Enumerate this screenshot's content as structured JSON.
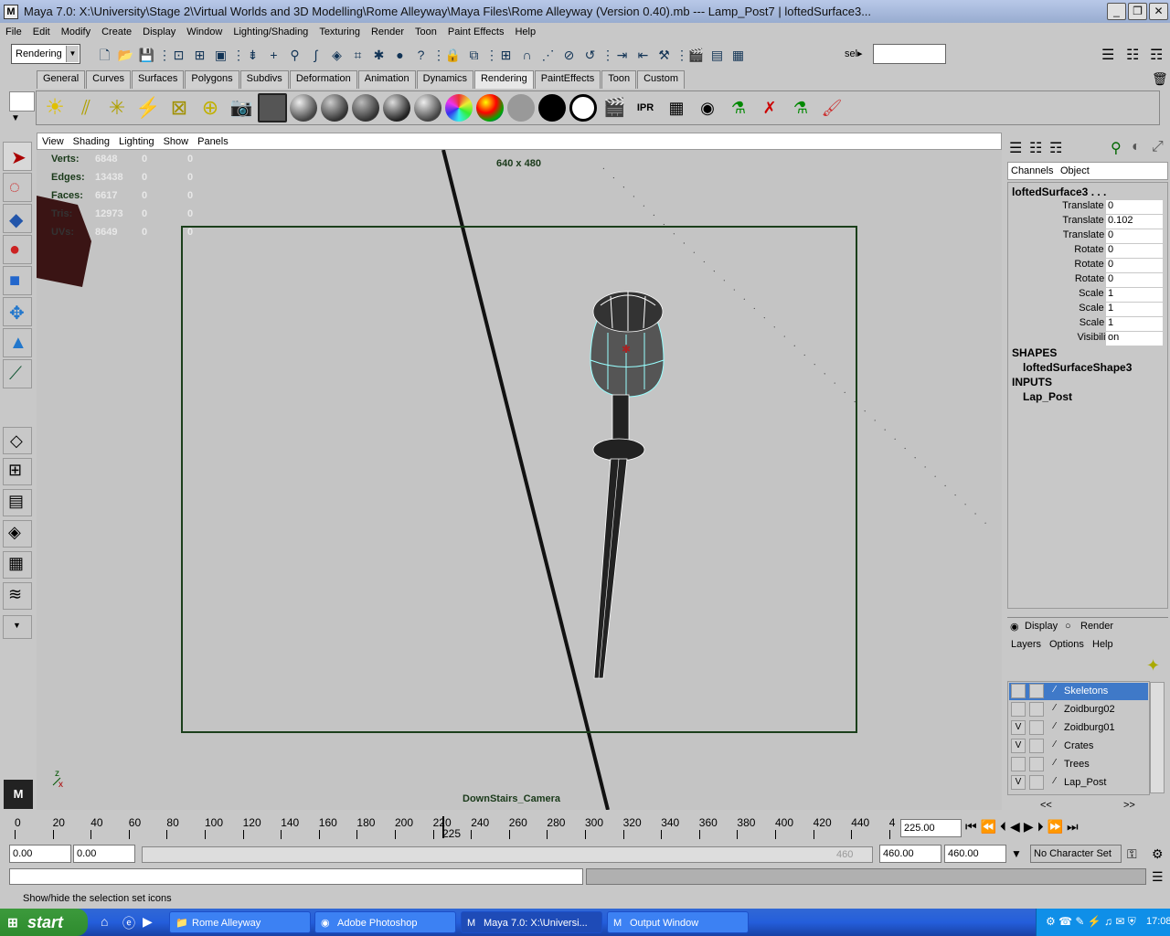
{
  "window": {
    "title": "Maya 7.0: X:\\University\\Stage 2\\Virtual Worlds and 3D Modelling\\Rome Alleyway\\Maya Files\\Rome Alleyway (Version 0.40).mb   ---   Lamp_Post7 | loftedSurface3...",
    "minimize": "_",
    "restore": "❐",
    "close": "✕"
  },
  "menubar": [
    "File",
    "Edit",
    "Modify",
    "Create",
    "Display",
    "Window",
    "Lighting/Shading",
    "Texturing",
    "Render",
    "Toon",
    "Paint Effects",
    "Help"
  ],
  "toolbar": {
    "mode": "Rendering",
    "sel_label": "sel▸"
  },
  "shelf_tabs": [
    "General",
    "Curves",
    "Surfaces",
    "Polygons",
    "Subdivs",
    "Deformation",
    "Animation",
    "Dynamics",
    "Rendering",
    "PaintEffects",
    "Toon",
    "Custom"
  ],
  "shelf_active": "Rendering",
  "viewport": {
    "menu": [
      "View",
      "Shading",
      "Lighting",
      "Show",
      "Panels"
    ],
    "resolution": "640 x 480",
    "camera": "DownStairs_Camera",
    "hud": [
      {
        "label": "Verts:",
        "v1": "6848",
        "v2": "0",
        "v3": "0"
      },
      {
        "label": "Edges:",
        "v1": "13438",
        "v2": "0",
        "v3": "0"
      },
      {
        "label": "Faces:",
        "v1": "6617",
        "v2": "0",
        "v3": "0"
      },
      {
        "label": "Tris:",
        "v1": "12973",
        "v2": "0",
        "v3": "0"
      },
      {
        "label": "UVs:",
        "v1": "8649",
        "v2": "0",
        "v3": "0"
      }
    ]
  },
  "channelbox": {
    "tabs": [
      "Channels",
      "Object"
    ],
    "object": "loftedSurface3 . . .",
    "attrs": [
      {
        "n": "Translate X",
        "v": "0"
      },
      {
        "n": "Translate Y",
        "v": "0.102"
      },
      {
        "n": "Translate Z",
        "v": "0"
      },
      {
        "n": "Rotate X",
        "v": "0"
      },
      {
        "n": "Rotate Y",
        "v": "0"
      },
      {
        "n": "Rotate Z",
        "v": "0"
      },
      {
        "n": "Scale X",
        "v": "1"
      },
      {
        "n": "Scale Y",
        "v": "1"
      },
      {
        "n": "Scale Z",
        "v": "1"
      },
      {
        "n": "Visibility",
        "v": "on"
      }
    ],
    "shapes_header": "SHAPES",
    "shape": "loftedSurfaceShape3",
    "inputs_header": "INPUTS",
    "input": "Lap_Post"
  },
  "layers": {
    "display": "Display",
    "render": "Render",
    "menu": [
      "Layers",
      "Options",
      "Help"
    ],
    "items": [
      {
        "v": "",
        "name": "Skeletons"
      },
      {
        "v": "",
        "name": "Zoidburg02"
      },
      {
        "v": "V",
        "name": "Zoidburg01"
      },
      {
        "v": "V",
        "name": "Crates"
      },
      {
        "v": "",
        "name": "Trees"
      },
      {
        "v": "V",
        "name": "Lap_Post"
      }
    ],
    "scroll_left": "<<",
    "scroll_right": ">>"
  },
  "timeline": {
    "ticks": [
      "0",
      "20",
      "40",
      "60",
      "80",
      "100",
      "120",
      "140",
      "160",
      "180",
      "200",
      "220",
      "240",
      "260",
      "280",
      "300",
      "320",
      "340",
      "360",
      "380",
      "400",
      "420",
      "440",
      "4"
    ],
    "current_marker": "225",
    "current_frame": "225.00"
  },
  "range": {
    "start": "0.00",
    "anim_start": "0.00",
    "range_end_label": "460",
    "anim_end": "460.00",
    "end": "460.00",
    "charset": "No Character Set"
  },
  "status": "Show/hide the selection set icons",
  "taskbar": {
    "start": "start",
    "tasks": [
      "Rome Alleyway",
      "Adobe Photoshop",
      "Maya 7.0: X:\\Universi...",
      "Output Window"
    ],
    "clock": "17:08"
  }
}
